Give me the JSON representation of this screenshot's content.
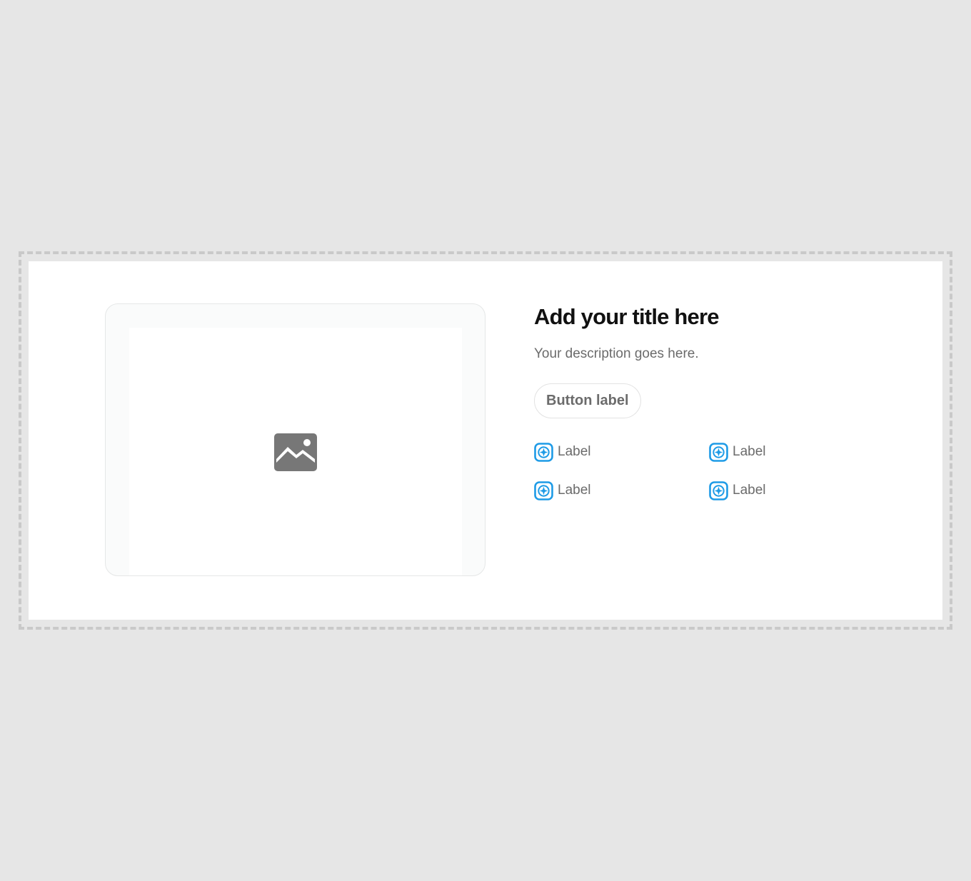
{
  "hero": {
    "title": "Add your title here",
    "description": "Your description goes here.",
    "button_label": "Button label",
    "media_icon": "image-placeholder-icon",
    "features": [
      {
        "label": "Label",
        "icon": "compass-icon"
      },
      {
        "label": "Label",
        "icon": "compass-icon"
      },
      {
        "label": "Label",
        "icon": "compass-icon"
      },
      {
        "label": "Label",
        "icon": "compass-icon"
      }
    ]
  },
  "colors": {
    "background": "#e6e6e6",
    "section": "#ffffff",
    "title": "#111111",
    "text_muted": "#6b6b6b",
    "icon_accent": "#1e9be6",
    "image_icon": "#777777"
  }
}
